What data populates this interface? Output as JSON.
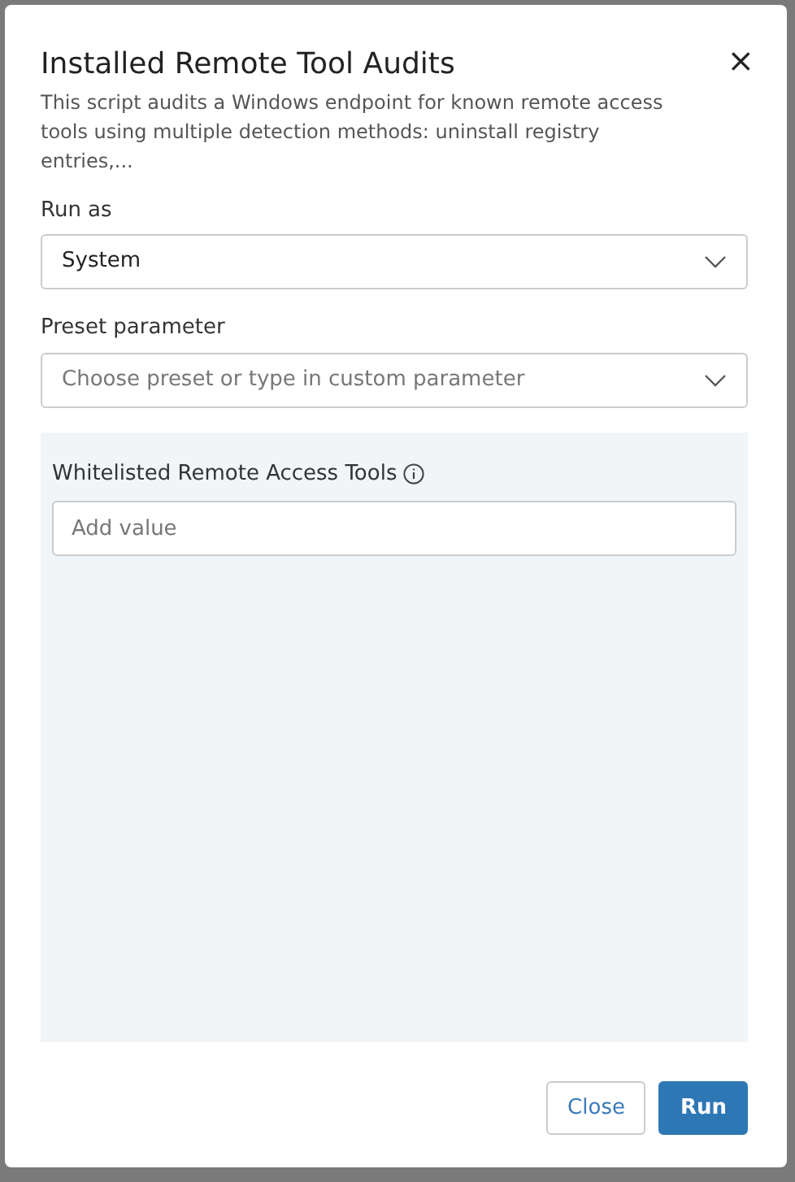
{
  "dialog": {
    "title": "Installed Remote Tool Audits",
    "close_icon": "×",
    "description": "This script audits a Windows endpoint for known remote access tools using multiple detection methods: uninstall registry entries,..."
  },
  "run_as": {
    "label": "Run as",
    "value": "System"
  },
  "preset": {
    "label": "Preset parameter",
    "placeholder": "Choose preset or type in custom parameter"
  },
  "parameters": [
    {
      "label": "Whitelisted Remote Access Tools",
      "info": true,
      "placeholder": "Add value"
    }
  ],
  "buttons": [
    {
      "label": "Close",
      "kind": "secondary"
    },
    {
      "label": "Run",
      "kind": "primary"
    }
  ]
}
